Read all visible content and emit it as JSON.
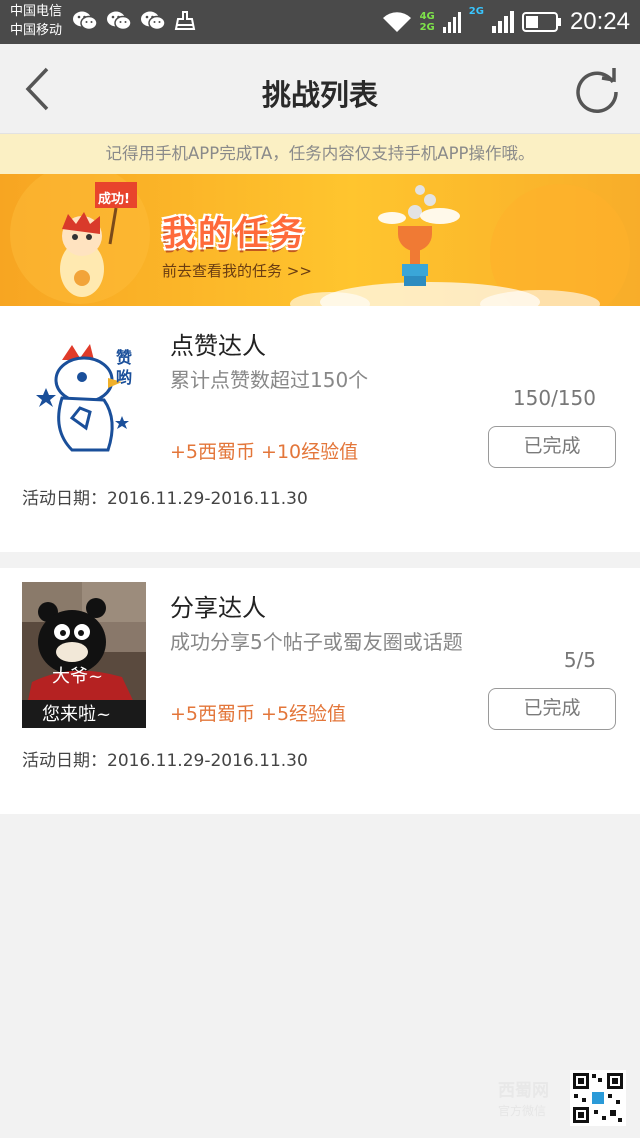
{
  "status_bar": {
    "carrier_1": "中国电信",
    "carrier_2": "中国移动",
    "net_4g": "4G",
    "net_2g_a": "2G",
    "net_2g_b": "2G",
    "time": "20:24",
    "icons": [
      "wechat-icon",
      "wechat-icon",
      "wechat-icon",
      "cleaner-icon",
      "wifi-icon",
      "signal-icon",
      "signal-icon",
      "battery-icon"
    ]
  },
  "navbar": {
    "back_icon": "back-chevron-icon",
    "title": "挑战列表",
    "refresh_icon": "refresh-icon"
  },
  "notice": {
    "text": "记得用手机APP完成TA，任务内容仅支持手机APP操作哦。"
  },
  "banner": {
    "badge": "成功!",
    "title": "我的任务",
    "subtitle": "前去查看我的任务 >>"
  },
  "tasks": [
    {
      "title": "点赞达人",
      "description": "累计点赞数超过150个",
      "reward": "+5西蜀币 +10经验值",
      "progress": "150/150",
      "status": "已完成",
      "date": "活动日期：2016.11.29-2016.11.30",
      "thumb_text": "赞哟"
    },
    {
      "title": "分享达人",
      "description": "成功分享5个帖子或蜀友圈或话题",
      "reward": "+5西蜀币 +5经验值",
      "progress": "5/5",
      "status": "已完成",
      "date": "活动日期：2016.11.29-2016.11.30",
      "thumb_line_1": "大爷~",
      "thumb_line_2": "您来啦~"
    }
  ],
  "watermark": {
    "text": "西蜀网",
    "sub": "官方微信"
  },
  "colors": {
    "accent_orange": "#e3763a",
    "banner_yellow": "#ffc52e",
    "notice_bg": "#fbf0c4",
    "status_bar_bg": "#4a4a4a"
  }
}
